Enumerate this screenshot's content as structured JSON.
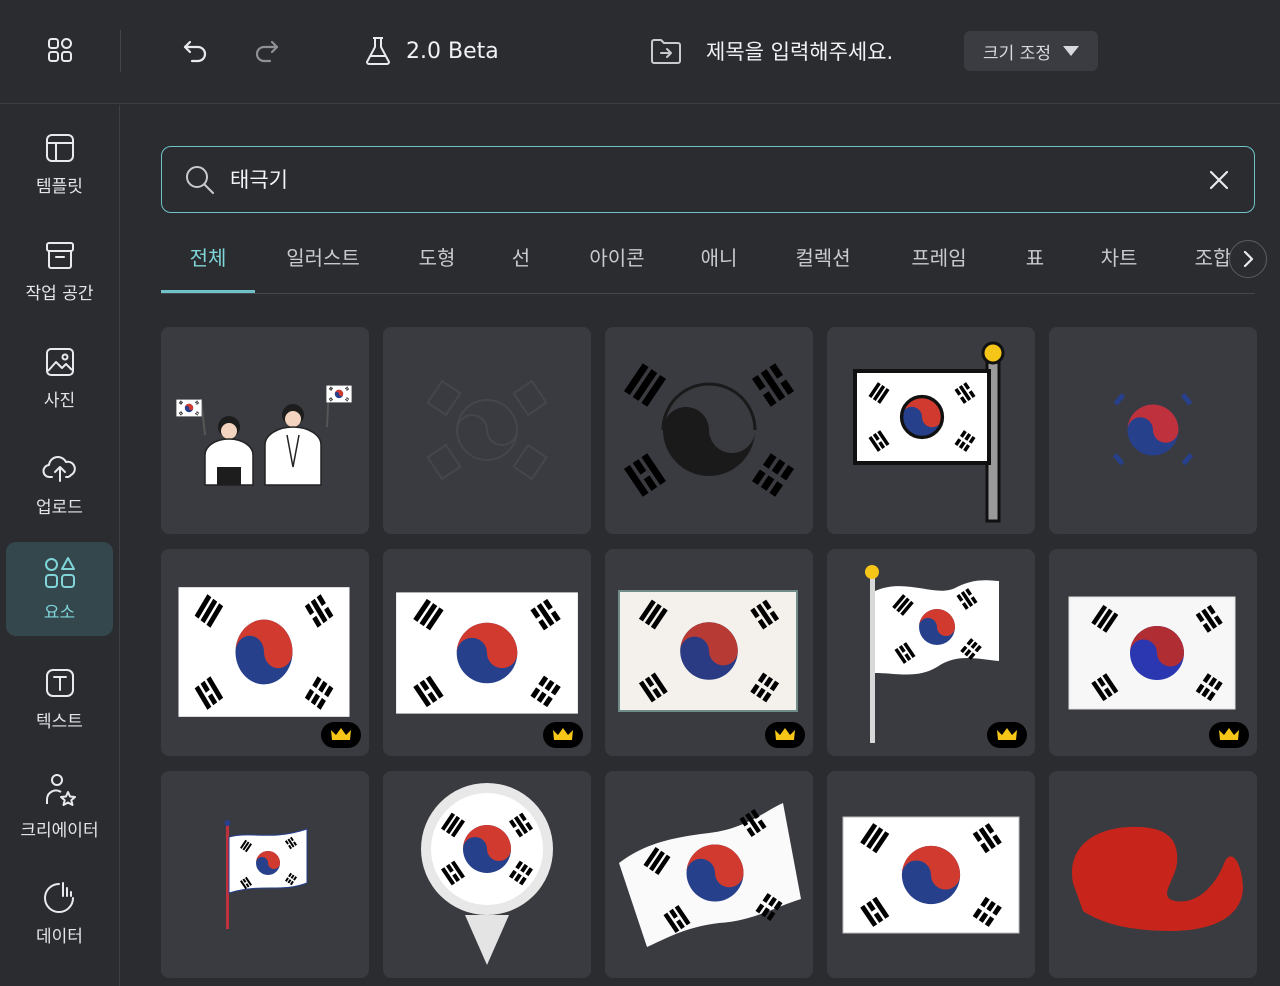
{
  "header": {
    "beta_label": "2.0 Beta",
    "title_placeholder": "제목을 입력해주세요.",
    "resize_label": "크기 조정"
  },
  "sidebar": {
    "items": [
      {
        "label": "템플릿",
        "icon": "template-icon"
      },
      {
        "label": "작업 공간",
        "icon": "archive-box-icon"
      },
      {
        "label": "사진",
        "icon": "photo-icon"
      },
      {
        "label": "업로드",
        "icon": "cloud-upload-icon"
      },
      {
        "label": "요소",
        "icon": "shapes-icon",
        "active": true
      },
      {
        "label": "텍스트",
        "icon": "text-box-icon"
      },
      {
        "label": "크리에이터",
        "icon": "creator-star-icon"
      },
      {
        "label": "데이터",
        "icon": "chart-pie-icon"
      }
    ]
  },
  "search": {
    "value": "태극기"
  },
  "tabs": [
    "전체",
    "일러스트",
    "도형",
    "선",
    "아이콘",
    "애니",
    "컬렉션",
    "프레임",
    "표",
    "차트",
    "조합"
  ],
  "colors": {
    "accent": "#6fc3c8",
    "background": "#2b2c30",
    "card": "#3a3b40",
    "red": "#d03a2f",
    "blue": "#27408b",
    "crown": "#f5c518"
  },
  "results": [
    {
      "name": "illustration-people-with-flags",
      "premium": false
    },
    {
      "name": "taegeuk-outline-faded",
      "premium": false
    },
    {
      "name": "taegeuk-black-silhouette",
      "premium": false
    },
    {
      "name": "flag-on-pole-cartoon",
      "premium": false
    },
    {
      "name": "taegeuk-small-icon",
      "premium": false
    },
    {
      "name": "flag-flat-1",
      "premium": true
    },
    {
      "name": "flag-flat-2",
      "premium": true
    },
    {
      "name": "flag-vintage",
      "premium": true
    },
    {
      "name": "flag-waving-pole",
      "premium": true
    },
    {
      "name": "flag-painted",
      "premium": true
    },
    {
      "name": "flag-small-pole",
      "premium": false
    },
    {
      "name": "flag-map-pin",
      "premium": false
    },
    {
      "name": "flag-waving-wide",
      "premium": false
    },
    {
      "name": "flag-flat-3",
      "premium": false
    },
    {
      "name": "red-brush-shape",
      "premium": false
    }
  ]
}
